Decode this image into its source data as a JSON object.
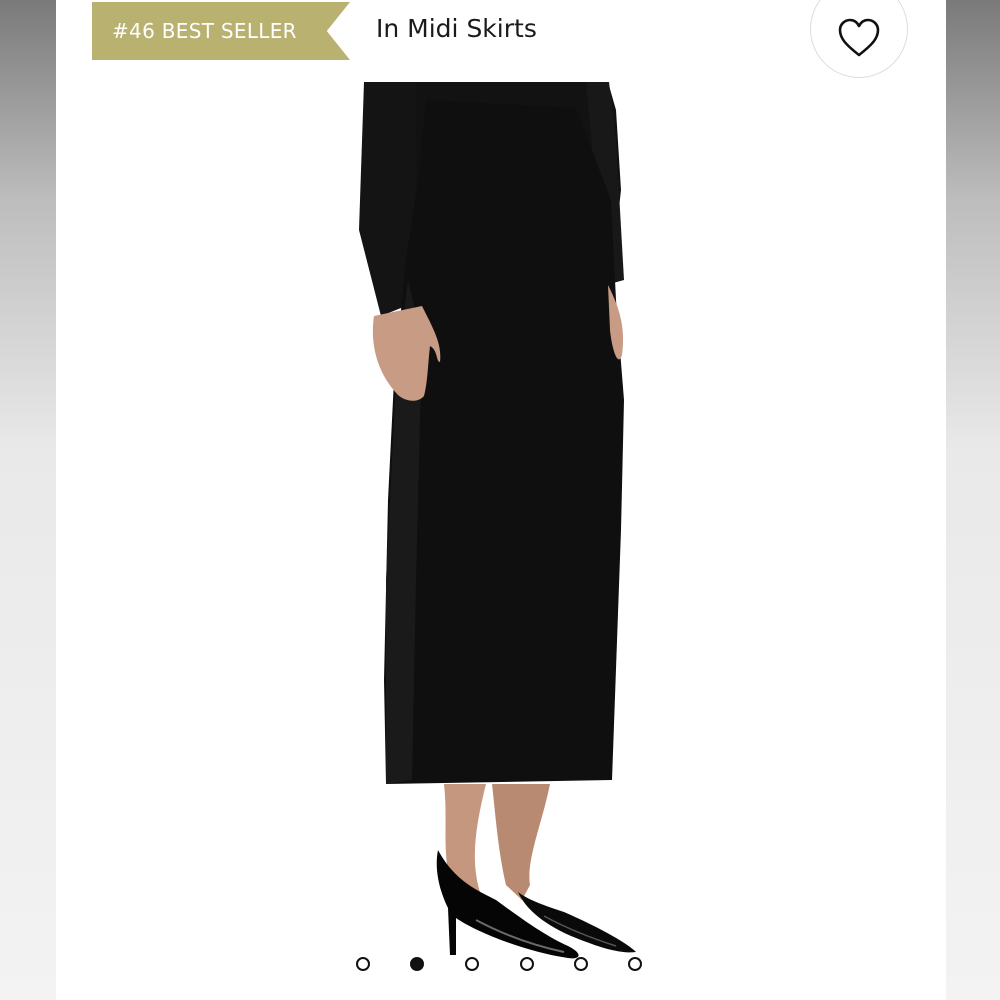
{
  "badge": {
    "text": "#46 BEST SELLER",
    "color": "#b9b16f"
  },
  "category": {
    "text": "In Midi Skirts"
  },
  "favorite": {
    "icon": "heart-outline-icon"
  },
  "product_image": {
    "subject": "black midi skirt with black top and black patent slingback heels"
  },
  "carousel": {
    "total": 6,
    "active_index": 1
  }
}
